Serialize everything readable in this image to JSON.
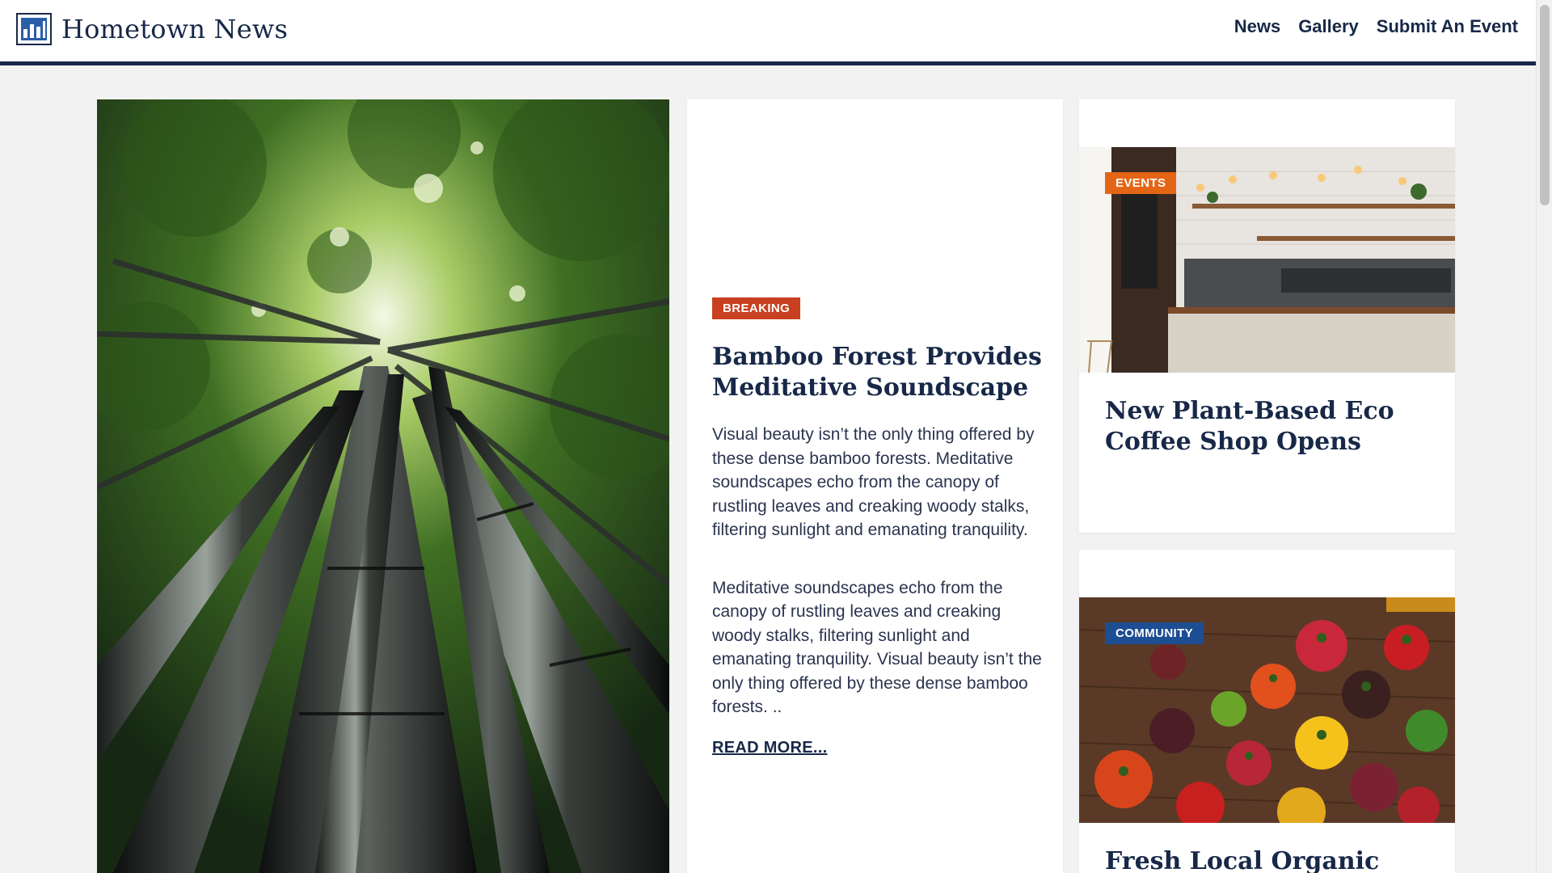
{
  "header": {
    "site_name": "Hometown News",
    "nav": [
      {
        "label": "News"
      },
      {
        "label": "Gallery"
      },
      {
        "label": "Submit An Event"
      }
    ]
  },
  "feature": {
    "badge": "BREAKING",
    "title": "Bamboo Forest Provides Meditative Soundscape",
    "paragraph_1": "Visual beauty isn’t the only thing offered by these dense bamboo forests. Meditative soundscapes echo from the canopy of rustling leaves and creaking woody stalks, filtering sunlight and emanating tranquility.",
    "paragraph_2": "Meditative soundscapes echo from the canopy of rustling leaves and creaking woody stalks, filtering sunlight and emanating tranquility. Visual beauty isn’t the only thing offered by these dense bamboo forests. ..",
    "read_more": "READ MORE..."
  },
  "cards": [
    {
      "badge": "EVENTS",
      "title": "New Plant-Based Eco Coffee Shop Opens"
    },
    {
      "badge": "COMMUNITY",
      "title": "Fresh Local Organic"
    }
  ],
  "colors": {
    "navy": "#172848",
    "breaking": "#c8401f",
    "events": "#e46615",
    "community": "#1d4e93",
    "page_bg": "#f2f2f2"
  },
  "icons": {
    "brand": "newspaper-icon"
  }
}
